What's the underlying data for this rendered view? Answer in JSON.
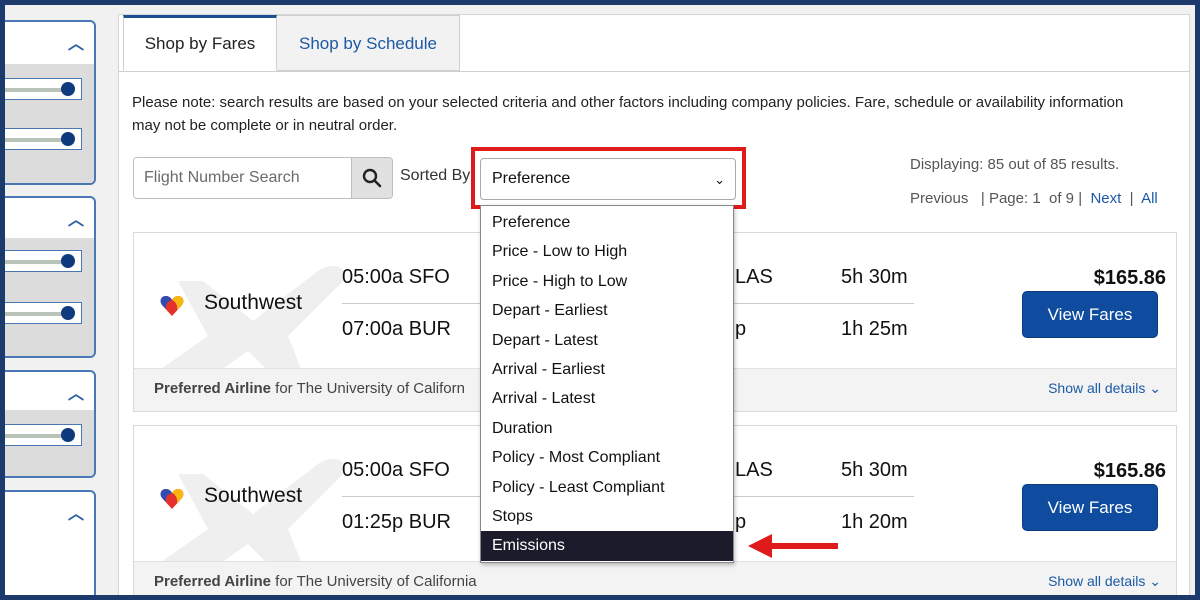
{
  "tabs": [
    {
      "label": "Shop by Fares",
      "active": true
    },
    {
      "label": "Shop by Schedule",
      "active": false
    }
  ],
  "notice": "Please note: search results are based on your selected criteria and other factors including company policies. Fare, schedule or availability information may not be complete or in neutral order.",
  "search": {
    "placeholder": "Flight Number Search"
  },
  "sort": {
    "label": "Sorted By",
    "selected": "Preference",
    "options": [
      "Preference",
      "Price - Low to High",
      "Price - High to Low",
      "Depart - Earliest",
      "Depart - Latest",
      "Arrival - Earliest",
      "Arrival - Latest",
      "Duration",
      "Policy - Most Compliant",
      "Policy - Least Compliant",
      "Stops",
      "Emissions"
    ],
    "highlighted": "Emissions"
  },
  "results": {
    "displaying": "Displaying: 85 out of 85 results.",
    "previous": "Previous",
    "page_label": "| Page:",
    "page": "1",
    "of_pages": "of 9",
    "sep": "|",
    "next": "Next",
    "all": "All"
  },
  "flights": [
    {
      "airline": "Southwest",
      "seg1": "05:00a SFO",
      "seg1_tail": "LAS",
      "seg1_dur": "5h 30m",
      "seg2": "07:00a BUR",
      "seg2_tail": "p",
      "seg2_dur": "1h 25m",
      "price": "$165.86",
      "button": "View Fares",
      "pref_bold": "Preferred Airline",
      "pref_rest": " for The University of Californ",
      "show_details": "Show all details ⌄"
    },
    {
      "airline": "Southwest",
      "seg1": "05:00a SFO",
      "seg1_tail": "LAS",
      "seg1_dur": "5h 30m",
      "seg2": "01:25p BUR",
      "seg2_tail": "p",
      "seg2_dur": "1h 20m",
      "price": "$165.86",
      "button": "View Fares",
      "pref_bold": "Preferred Airline",
      "pref_rest": " for The University of California",
      "show_details": "Show all details ⌄"
    }
  ],
  "colors": {
    "accent": "#0f4b9e",
    "highlight_box": "#e01b1b",
    "frame": "#1c3a6b"
  }
}
